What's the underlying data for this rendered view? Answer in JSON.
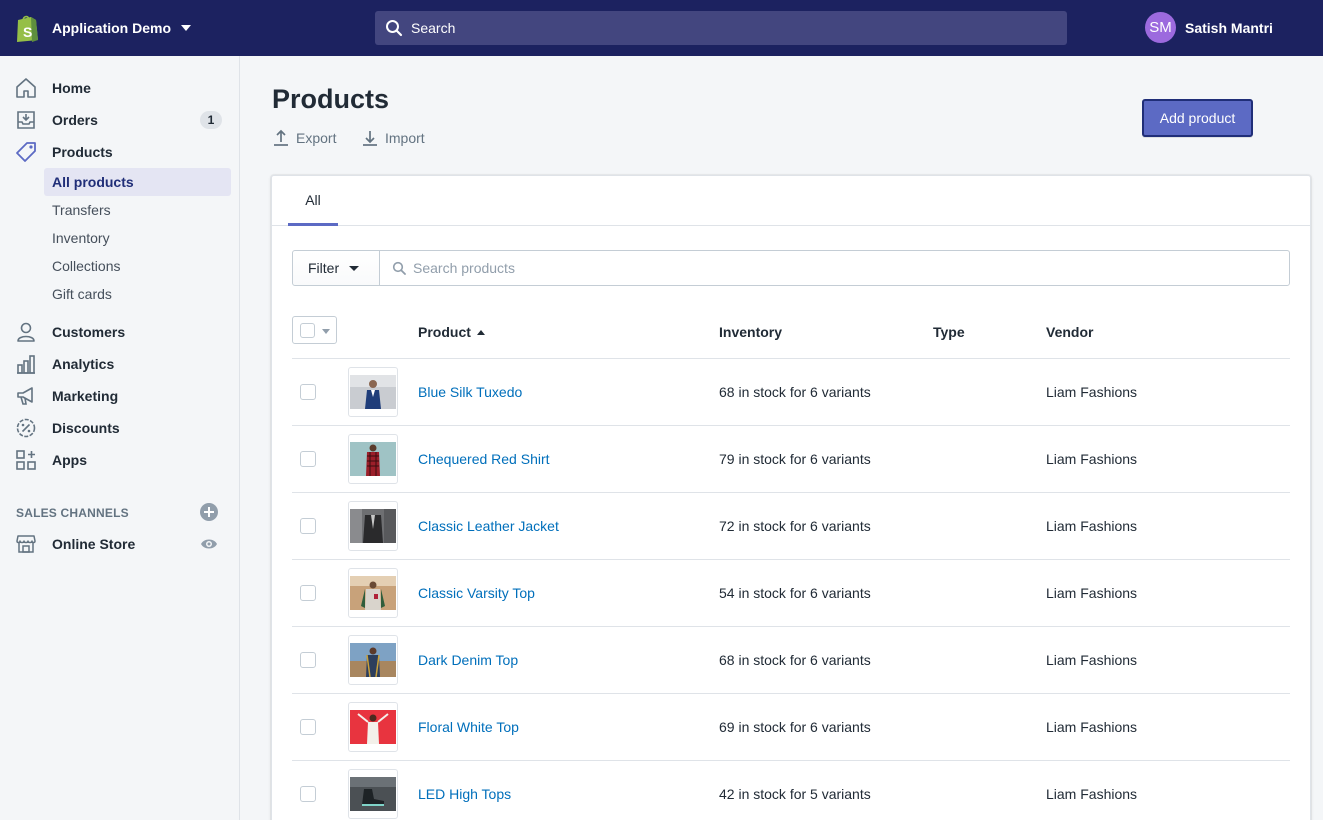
{
  "topbar": {
    "store_name": "Application Demo",
    "search_placeholder": "Search",
    "user_initials": "SM",
    "user_name": "Satish Mantri"
  },
  "sidebar": {
    "items": [
      {
        "label": "Home",
        "icon": "home-icon"
      },
      {
        "label": "Orders",
        "icon": "orders-icon",
        "badge": "1"
      },
      {
        "label": "Products",
        "icon": "tag-icon"
      }
    ],
    "product_subitems": [
      "All products",
      "Transfers",
      "Inventory",
      "Collections",
      "Gift cards"
    ],
    "items_after": [
      {
        "label": "Customers",
        "icon": "person-icon"
      },
      {
        "label": "Analytics",
        "icon": "bar-chart-icon"
      },
      {
        "label": "Marketing",
        "icon": "megaphone-icon"
      },
      {
        "label": "Discounts",
        "icon": "discount-icon"
      },
      {
        "label": "Apps",
        "icon": "apps-icon"
      }
    ],
    "sales_channels_heading": "SALES CHANNELS",
    "online_store_label": "Online Store"
  },
  "main": {
    "title": "Products",
    "export_label": "Export",
    "import_label": "Import",
    "add_product_label": "Add product",
    "tab_all": "All",
    "filter_label": "Filter",
    "search_placeholder": "Search products",
    "columns": {
      "product": "Product",
      "inventory": "Inventory",
      "type": "Type",
      "vendor": "Vendor"
    },
    "rows": [
      {
        "name": "Blue Silk Tuxedo",
        "inventory": "68 in stock for 6 variants",
        "type": "",
        "vendor": "Liam Fashions"
      },
      {
        "name": "Chequered Red Shirt",
        "inventory": "79 in stock for 6 variants",
        "type": "",
        "vendor": "Liam Fashions"
      },
      {
        "name": "Classic Leather Jacket",
        "inventory": "72 in stock for 6 variants",
        "type": "",
        "vendor": "Liam Fashions"
      },
      {
        "name": "Classic Varsity Top",
        "inventory": "54 in stock for 6 variants",
        "type": "",
        "vendor": "Liam Fashions"
      },
      {
        "name": "Dark Denim Top",
        "inventory": "68 in stock for 6 variants",
        "type": "",
        "vendor": "Liam Fashions"
      },
      {
        "name": "Floral White Top",
        "inventory": "69 in stock for 6 variants",
        "type": "",
        "vendor": "Liam Fashions"
      },
      {
        "name": "LED High Tops",
        "inventory": "42 in stock for 5 variants",
        "type": "",
        "vendor": "Liam Fashions"
      }
    ]
  },
  "colors": {
    "topbar": "#1c2260",
    "accent": "#5c6ac4",
    "link": "#006fbb"
  }
}
